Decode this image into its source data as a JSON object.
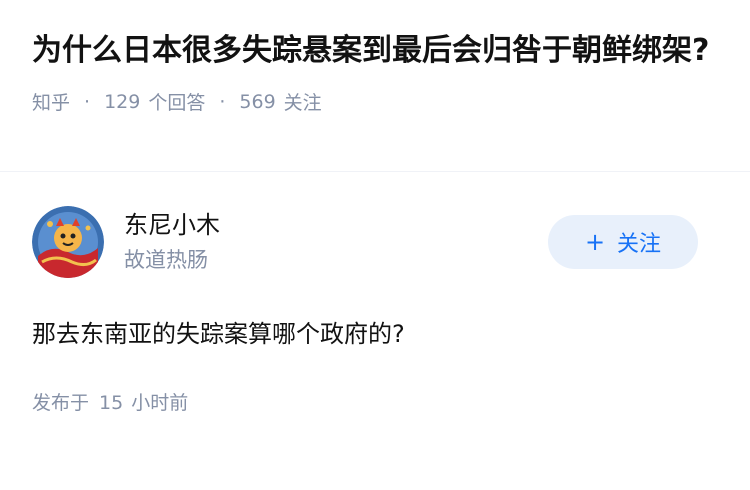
{
  "question": {
    "title": "为什么日本很多失踪悬案到最后会归咎于朝鲜绑架?",
    "source": "知乎",
    "answers_count": "129",
    "answers_label": "个回答",
    "followers_count": "569",
    "followers_label": "关注"
  },
  "answer": {
    "author_name": "东尼小木",
    "author_bio": "故道热肠",
    "follow_icon": "plus-icon",
    "follow_label": "关注",
    "content": "那去东南亚的失踪案算哪个政府的?",
    "time_prefix": "发布于",
    "time_value": "15",
    "time_unit": "小时前"
  }
}
